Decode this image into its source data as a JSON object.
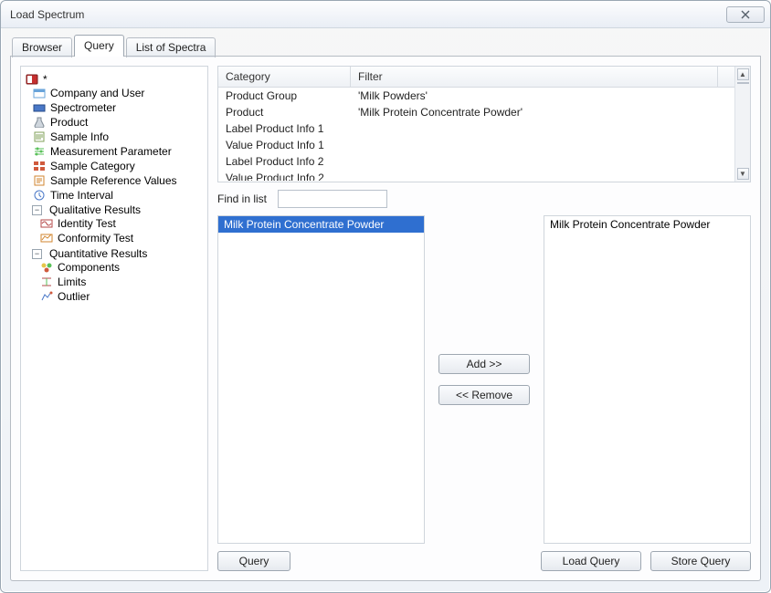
{
  "window": {
    "title": "Load Spectrum"
  },
  "tabs": [
    {
      "label": "Browser",
      "active": false
    },
    {
      "label": "Query",
      "active": true
    },
    {
      "label": "List of Spectra",
      "active": false
    }
  ],
  "tree": {
    "root_label": "*",
    "items": [
      {
        "label": "Company and User"
      },
      {
        "label": "Spectrometer"
      },
      {
        "label": "Product"
      },
      {
        "label": "Sample Info"
      },
      {
        "label": "Measurement Parameter"
      },
      {
        "label": "Sample Category"
      },
      {
        "label": "Sample Reference Values"
      },
      {
        "label": "Time Interval"
      }
    ],
    "qualitative": {
      "label": "Qualitative Results",
      "children": [
        {
          "label": "Identity Test"
        },
        {
          "label": "Conformity Test"
        }
      ]
    },
    "quantitative": {
      "label": "Quantitative Results",
      "children": [
        {
          "label": "Components"
        },
        {
          "label": "Limits"
        },
        {
          "label": "Outlier"
        }
      ]
    }
  },
  "grid": {
    "headers": {
      "category": "Category",
      "filter": "Filter"
    },
    "rows": [
      {
        "category": "Product Group",
        "filter": "'Milk Powders'"
      },
      {
        "category": "Product",
        "filter": "'Milk Protein Concentrate Powder'"
      },
      {
        "category": "Label Product Info 1",
        "filter": ""
      },
      {
        "category": "Value Product Info 1",
        "filter": ""
      },
      {
        "category": "Label Product Info 2",
        "filter": ""
      },
      {
        "category": "Value Product Info 2",
        "filter": ""
      }
    ]
  },
  "find": {
    "label": "Find in list",
    "value": ""
  },
  "left_list": {
    "items": [
      {
        "label": "Milk Protein Concentrate Powder",
        "selected": true
      }
    ]
  },
  "right_list": {
    "items": [
      {
        "label": "Milk Protein Concentrate Powder",
        "selected": false
      }
    ]
  },
  "buttons": {
    "add": "Add >>",
    "remove": "<< Remove",
    "query": "Query",
    "load_query": "Load Query",
    "store_query": "Store Query"
  }
}
